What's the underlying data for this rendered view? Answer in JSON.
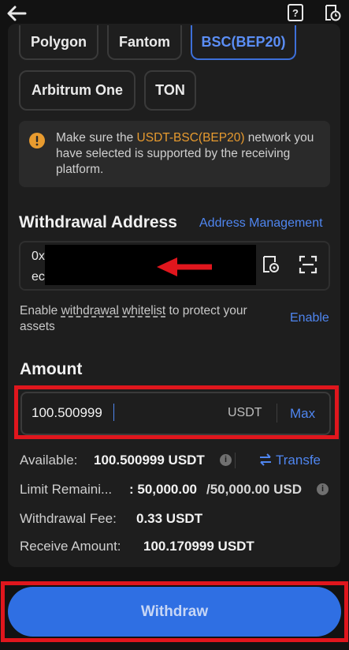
{
  "header": {
    "back_icon": "arrow-left-icon",
    "help_icon": "help-document-icon",
    "history_icon": "history-icon"
  },
  "networks": {
    "row1": [
      "Polygon",
      "Fantom",
      "BSC(BEP20)"
    ],
    "row2": [
      "Arbitrum One",
      "TON"
    ],
    "selected": "BSC(BEP20)"
  },
  "notice": {
    "prefix": "Make sure the ",
    "highlight": "USDT-BSC(BEP20)",
    "suffix": " network you have selected is supported by the receiving platform."
  },
  "address": {
    "title": "Withdrawal Address",
    "manage_link": "Address Management",
    "value_line1": "0x",
    "value_line2": "ec",
    "whitelist_prefix": "Enable ",
    "whitelist_link": "withdrawal whitelist",
    "whitelist_suffix": " to protect your assets",
    "enable_label": "Enable"
  },
  "amount": {
    "title": "Amount",
    "value": "100.500999",
    "unit": "USDT",
    "max_label": "Max"
  },
  "info": {
    "available_label": "Available:",
    "available_value": "100.500999 USDT",
    "transfer_label": "Transfe",
    "limit_label": "Limit Remaini...",
    "limit_value_used": ": 50,000.00",
    "limit_value_total": "/50,000.00 USD",
    "fee_label": "Withdrawal Fee:",
    "fee_value": "0.33 USDT",
    "receive_label": "Receive Amount:",
    "receive_value": "100.170999 USDT"
  },
  "withdraw_button": "Withdraw",
  "colors": {
    "accent": "#2f6fe3",
    "highlight": "#e89b2f",
    "annotation": "#e0161d"
  }
}
